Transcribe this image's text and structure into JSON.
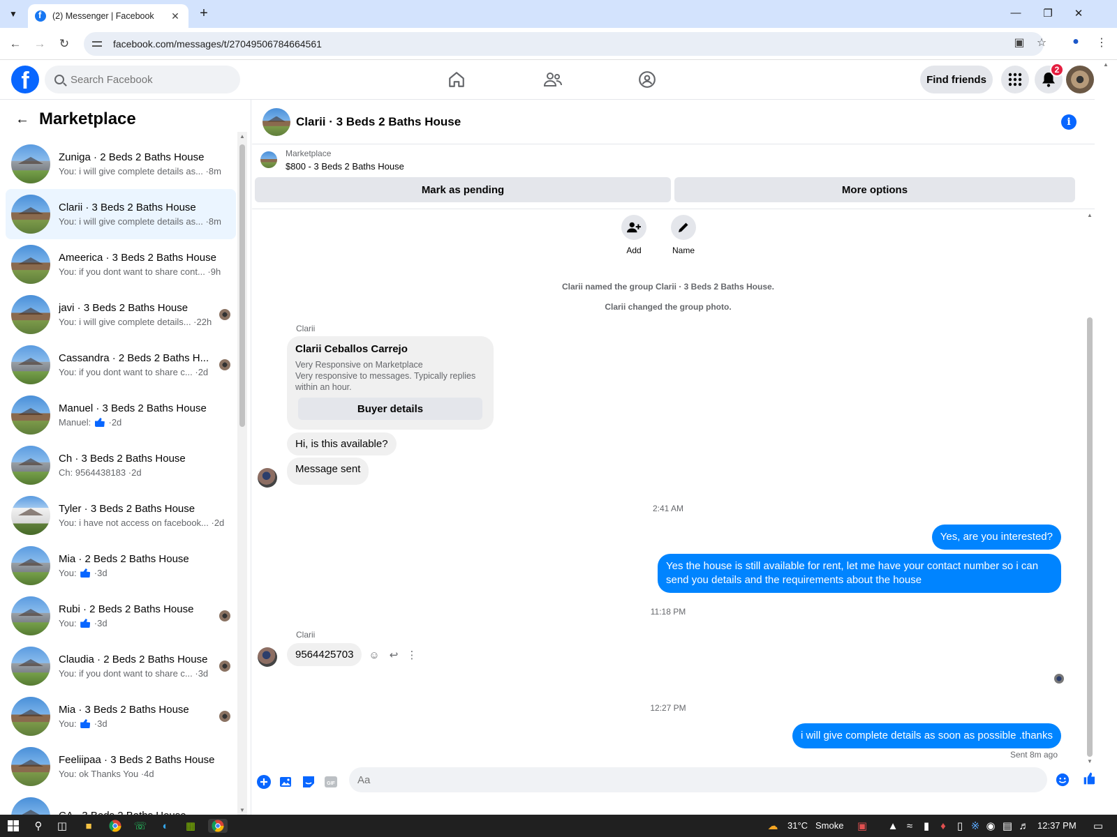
{
  "browser": {
    "tab_title": "(2) Messenger | Facebook",
    "url": "facebook.com/messages/t/27049506784664561"
  },
  "fb": {
    "search_placeholder": "Search Facebook",
    "find_friends": "Find friends",
    "notification_count": "2"
  },
  "sidebar": {
    "title": "Marketplace",
    "conversations": [
      {
        "name": "Zuniga · 2 Beds 2 Baths House",
        "preview": "You: i will give complete details as... ·8m",
        "photo": "gray"
      },
      {
        "name": "Clarii · 3 Beds 2 Baths House",
        "preview": "You: i will give complete details as... ·8m",
        "photo": "brown",
        "active": true
      },
      {
        "name": "Ameerica · 3 Beds 2 Baths House",
        "preview": "You: if you dont want to share cont... ·9h",
        "photo": "brown"
      },
      {
        "name": "javi · 3 Beds 2 Baths House",
        "preview": "You: i will give complete details... ·22h",
        "photo": "brown"
      },
      {
        "name": "Cassandra · 2 Beds 2 Baths H...",
        "preview": "You: if you dont want to share c... ·2d",
        "photo": "gray"
      },
      {
        "name": "Manuel · 3 Beds 2 Baths House",
        "preview_prefix": "Manuel: ",
        "preview_suffix": " ·2d",
        "photo": "brown"
      },
      {
        "name": "Ch · 3 Beds 2 Baths House",
        "preview": "Ch: 9564438183 ·2d",
        "photo": "gray"
      },
      {
        "name": "Tyler · 3 Beds 2 Baths House",
        "preview": "You: i have not access on facebook... ·2d",
        "photo": "white"
      },
      {
        "name": "Mia · 2 Beds 2 Baths House",
        "preview_prefix": "You: ",
        "preview_suffix": " ·3d",
        "photo": "gray"
      },
      {
        "name": "Rubi · 2 Beds 2 Baths House",
        "preview_prefix": "You: ",
        "preview_suffix": " ·3d",
        "photo": "gray"
      },
      {
        "name": "Claudia · 2 Beds 2 Baths House",
        "preview": "You: if you dont want to share c... ·3d",
        "photo": "gray"
      },
      {
        "name": "Mia · 3 Beds 2 Baths House",
        "preview_prefix": "You: ",
        "preview_suffix": " ·3d",
        "photo": "brown"
      },
      {
        "name": "Feeliipaa · 3 Beds 2 Baths House",
        "preview": "You: ok Thanks You ·4d",
        "photo": "brown"
      },
      {
        "name": "CA · 3 Beds 2 Baths House",
        "preview": "",
        "photo": "brown"
      }
    ]
  },
  "chat": {
    "title": "Clarii · 3 Beds 2 Baths House",
    "listing_label": "Marketplace",
    "listing_price": "$800 - 3 Beds 2 Baths House",
    "mark_pending": "Mark as pending",
    "more_options": "More options",
    "actions": {
      "add": "Add",
      "name": "Name"
    },
    "system_1": "Clarii named the group Clarii · 3 Beds 2 Baths House.",
    "system_2": "Clarii changed the group photo.",
    "sender": "Clarii",
    "card_name": "Clarii Ceballos Carrejo",
    "card_line1": "Very Responsive on Marketplace",
    "card_line2": "Very responsive to messages. Typically replies within an hour.",
    "buyer_details": "Buyer details",
    "msg_available": "Hi, is this available?",
    "msg_sent": "Message sent",
    "time_1": "2:41 AM",
    "out_1": "Yes, are you interested?",
    "out_2": "Yes the house is still available for rent, let me have your contact number so i can send you details and the requirements about the house",
    "time_2": "11:18 PM",
    "sender_2": "Clarii",
    "in_number": "9564425703",
    "time_3": "12:27 PM",
    "out_3": "i will give complete details as soon as possible .thanks",
    "sent_status": "Sent 8m ago",
    "composer_placeholder": "Aa"
  },
  "taskbar": {
    "weather": "31°C",
    "condition": "Smoke",
    "clock": "12:37 PM"
  },
  "colors": {
    "fb_blue": "#0866ff",
    "bubble_out": "#0084ff",
    "active_row": "#ebf5ff"
  }
}
